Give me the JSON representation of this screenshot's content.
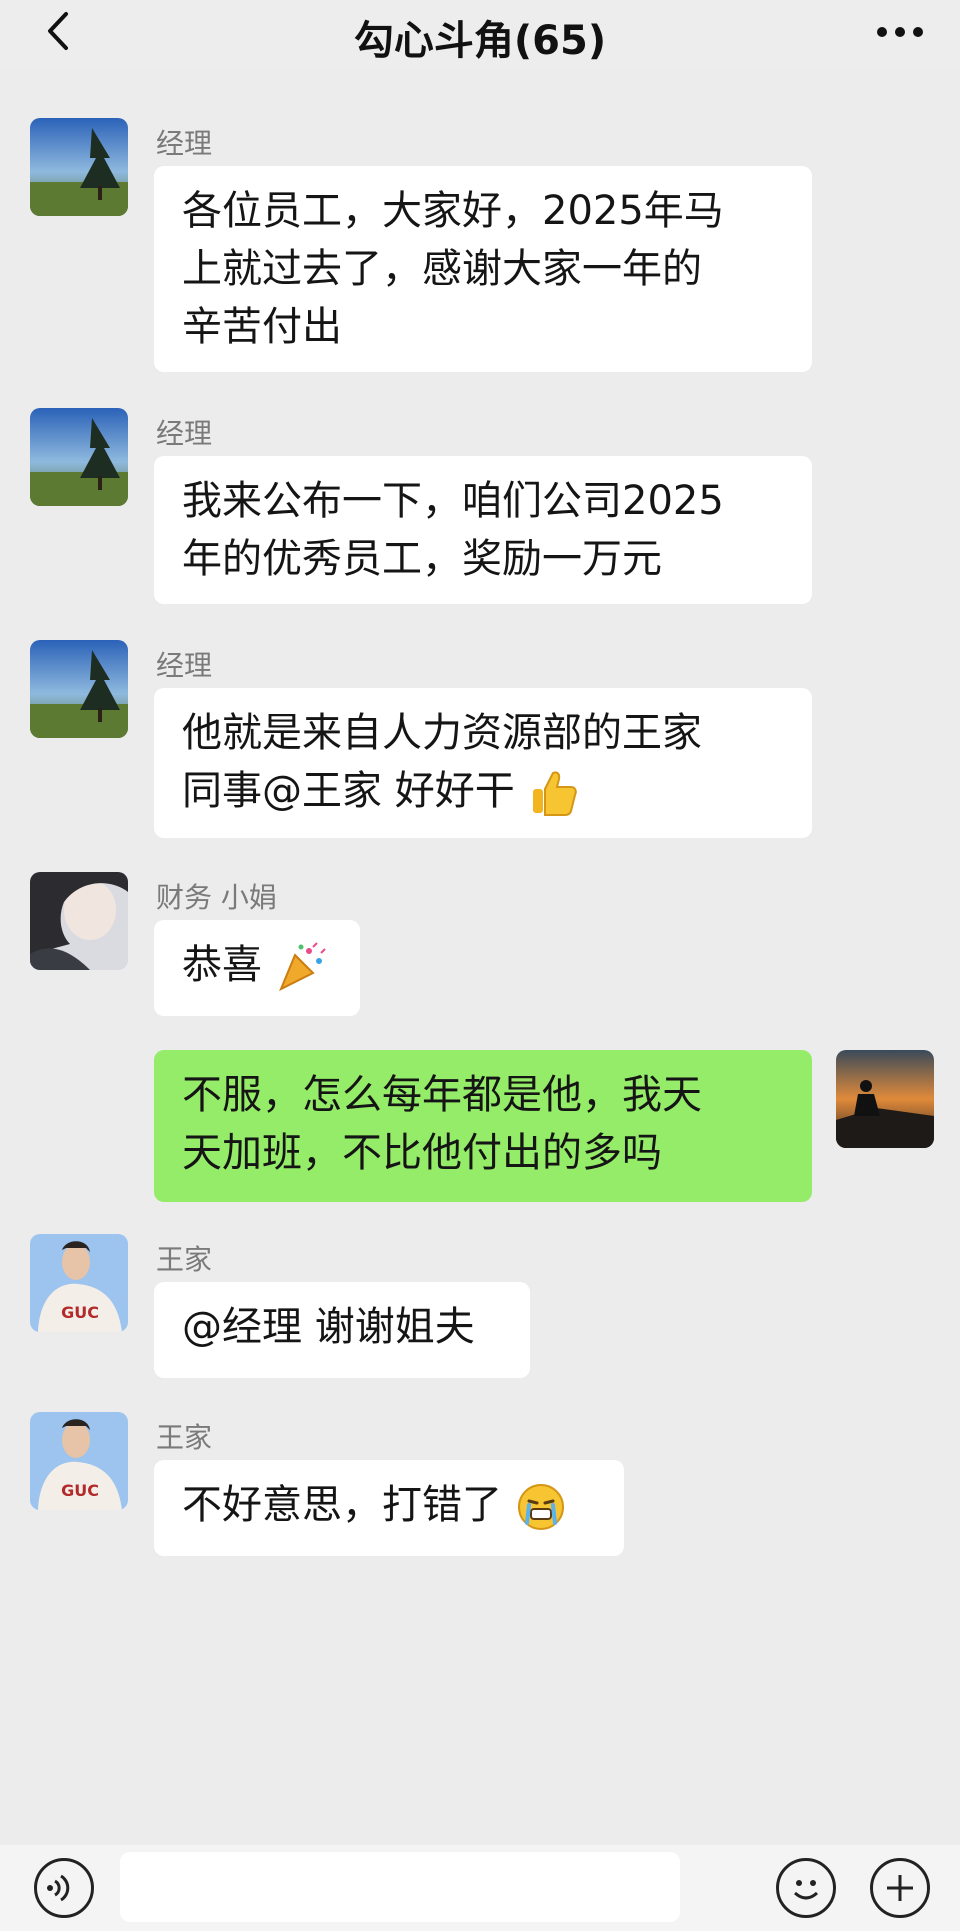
{
  "header": {
    "title": "勾心斗角(65)",
    "back_icon": "chevron-left-icon",
    "more_icon": "more-dots-icon"
  },
  "messages": [
    {
      "sender": "经理",
      "text": "各位员工，大家好，2025年马上就过去了，感谢大家一年的辛苦付出",
      "lines": [
        "各位员工，大家好，2025年马",
        "上就过去了，感谢大家一年的",
        "辛苦付出"
      ],
      "self": false
    },
    {
      "sender": "经理",
      "text": "我来公布一下，咱们公司2025年的优秀员工，奖励一万元",
      "lines": [
        "我来公布一下，咱们公司2025",
        "年的优秀员工，奖励一万元"
      ],
      "self": false
    },
    {
      "sender": "经理",
      "text": "他就是来自人力资源部的王家同事@王家 好好干",
      "lines": [
        "他就是来自人力资源部的王家",
        "同事@王家 好好干"
      ],
      "emoji": "thumbs-up-emoji",
      "self": false
    },
    {
      "sender": "财务 小娟",
      "text": "恭喜",
      "lines": [
        "恭喜"
      ],
      "emoji": "party-popper-emoji",
      "self": false
    },
    {
      "sender": "",
      "text": "不服，怎么每年都是他，我天天加班，不比他付出的多吗",
      "lines": [
        "不服，怎么每年都是他，我天",
        "天加班，不比他付出的多吗"
      ],
      "self": true
    },
    {
      "sender": "王家",
      "text": "@经理 谢谢姐夫",
      "lines": [
        "@经理 谢谢姐夫"
      ],
      "self": false
    },
    {
      "sender": "王家",
      "text": "不好意思，打错了",
      "lines": [
        "不好意思，打错了"
      ],
      "emoji": "crying-emoji",
      "self": false
    }
  ],
  "colors": {
    "background": "#ececec",
    "bubble_other": "#ffffff",
    "bubble_self": "#95ec69",
    "sender_name": "#7a7a7a"
  },
  "footer": {
    "voice_icon": "voice-icon",
    "emoji_icon": "emoji-icon",
    "plus_icon": "plus-icon"
  }
}
